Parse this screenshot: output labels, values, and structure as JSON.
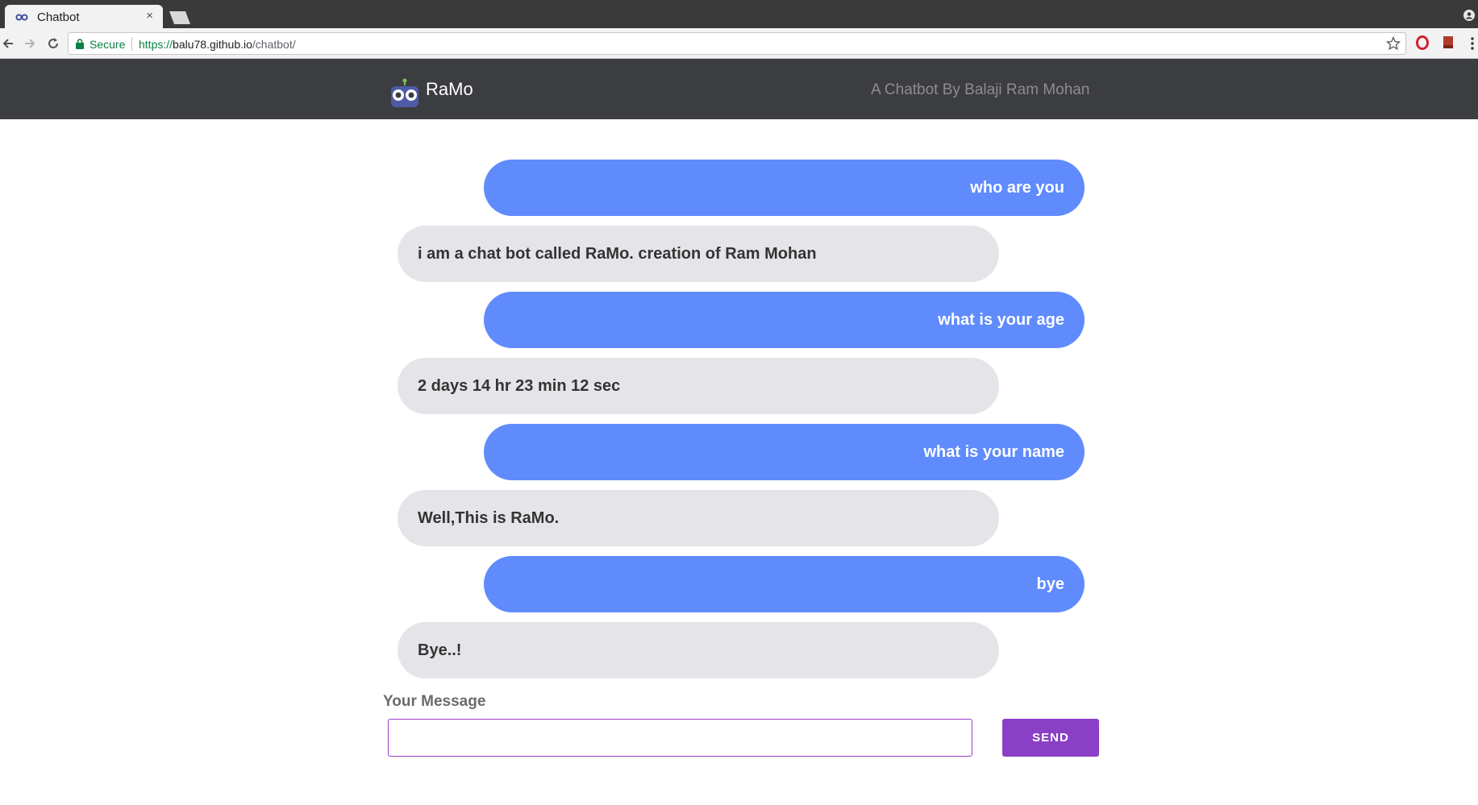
{
  "browser": {
    "tab_title": "Chatbot",
    "tab_close": "×",
    "secure_label": "Secure",
    "url_scheme": "https://",
    "url_host": "balu78.github.io",
    "url_path": "/chatbot/"
  },
  "header": {
    "brand_name": "RaMo",
    "tagline": "A Chatbot By Balaji Ram Mohan"
  },
  "messages": [
    {
      "sender": "user",
      "text": "who are you"
    },
    {
      "sender": "bot",
      "text": "i am a chat bot called RaMo. creation of Ram Mohan"
    },
    {
      "sender": "user",
      "text": "what is your age"
    },
    {
      "sender": "bot",
      "text": "2 days 14 hr 23 min 12 sec"
    },
    {
      "sender": "user",
      "text": "what is your name"
    },
    {
      "sender": "bot",
      "text": "Well,This is RaMo."
    },
    {
      "sender": "user",
      "text": "bye"
    },
    {
      "sender": "bot",
      "text": "Bye..!"
    }
  ],
  "composer": {
    "label": "Your Message",
    "input_value": "",
    "send_label": "SEND"
  },
  "colors": {
    "header_bg": "#3c3d41",
    "user_bubble": "#5f8bfc",
    "bot_bubble": "#e5e5e9",
    "accent": "#8a3fc6"
  },
  "icons": [
    "robot-logo-icon",
    "lock-icon",
    "back-icon",
    "forward-icon",
    "reload-icon",
    "star-icon",
    "opera-icon",
    "bookmark-ext-icon",
    "menu-icon"
  ]
}
